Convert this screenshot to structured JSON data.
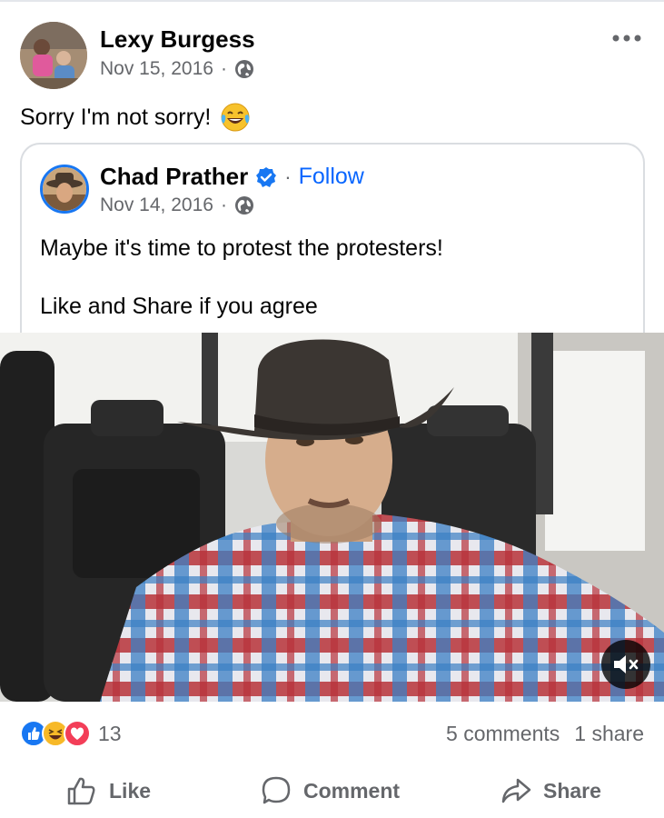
{
  "post": {
    "author": "Lexy Burgess",
    "date": "Nov 15, 2016",
    "meta_separator": "·",
    "text": "Sorry I'm not sorry!",
    "emoji": "face-with-tears-of-joy-icon"
  },
  "shared": {
    "author": "Chad Prather",
    "separator": "·",
    "follow_label": "Follow",
    "date": "Nov 14, 2016",
    "meta_separator": "·",
    "line1": "Maybe it's time to protest the protesters!",
    "line2": "Like and Share if you agree"
  },
  "video": {
    "muted": true
  },
  "engagement": {
    "reactions": [
      "like-icon",
      "haha-icon",
      "love-icon"
    ],
    "reaction_count": "13",
    "comments": "5 comments",
    "shares": "1 share"
  },
  "actions": {
    "like_label": "Like",
    "comment_label": "Comment",
    "share_label": "Share"
  },
  "colors": {
    "accent": "#0866ff",
    "secondary_text": "#65676b",
    "like": "#1877f2",
    "love": "#f33e58",
    "haha": "#f7b928"
  }
}
